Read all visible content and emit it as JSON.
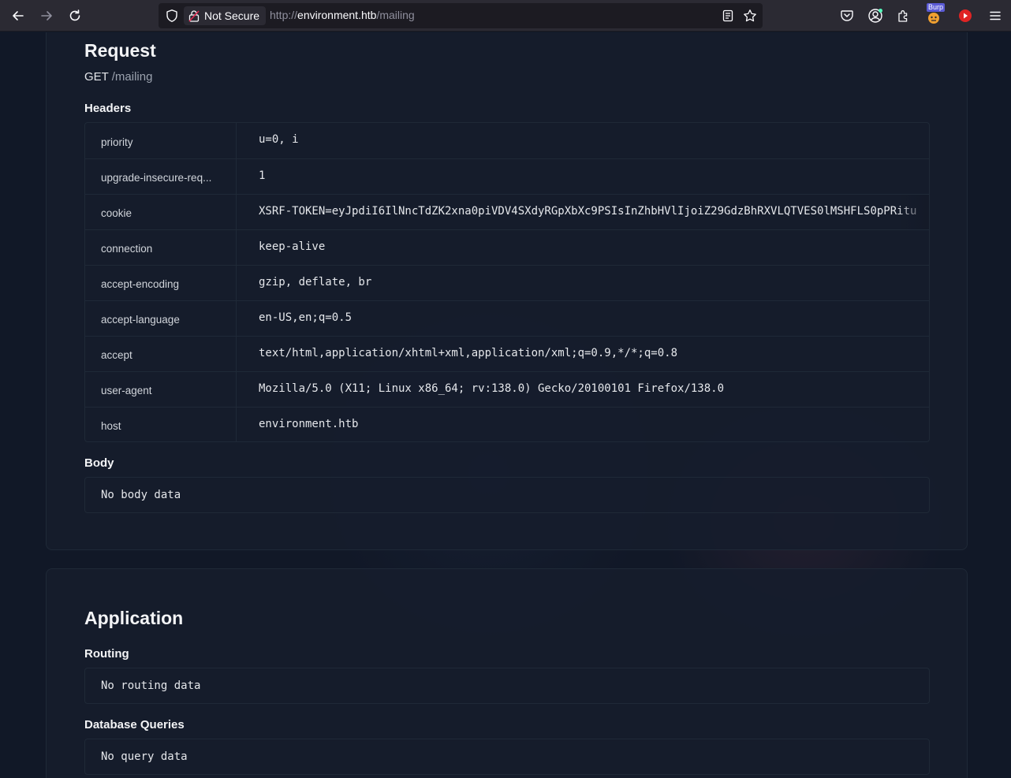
{
  "browser": {
    "back_icon": "arrow-left-icon",
    "forward_icon": "arrow-right-icon",
    "reload_icon": "reload-icon",
    "security_label": "Not Secure",
    "url_scheme": "http://",
    "url_host": "environment.htb",
    "url_path": "/mailing",
    "extension_badge": "Burp"
  },
  "request": {
    "title": "Request",
    "method": "GET",
    "path": "/mailing",
    "headers_title": "Headers",
    "headers": [
      {
        "key": "priority",
        "value": "u=0, i"
      },
      {
        "key": "upgrade-insecure-req...",
        "value": "1"
      },
      {
        "key": "cookie",
        "value": "XSRF-TOKEN=eyJpdiI6IlNncTdZK2xna0piVDV4SXdyRGpXbXc9PSIsInZhbHVlIjoiZ29GdzBhRXVLQTVES0lMSHFLS0pPRitu"
      },
      {
        "key": "connection",
        "value": "keep-alive"
      },
      {
        "key": "accept-encoding",
        "value": "gzip, deflate, br"
      },
      {
        "key": "accept-language",
        "value": "en-US,en;q=0.5"
      },
      {
        "key": "accept",
        "value": "text/html,application/xhtml+xml,application/xml;q=0.9,*/*;q=0.8"
      },
      {
        "key": "user-agent",
        "value": "Mozilla/5.0 (X11; Linux x86_64; rv:138.0) Gecko/20100101 Firefox/138.0"
      },
      {
        "key": "host",
        "value": "environment.htb"
      }
    ],
    "body_title": "Body",
    "body_value": "No body data"
  },
  "application": {
    "title": "Application",
    "routing_title": "Routing",
    "routing_value": "No routing data",
    "queries_title": "Database Queries",
    "queries_value": "No query data"
  }
}
